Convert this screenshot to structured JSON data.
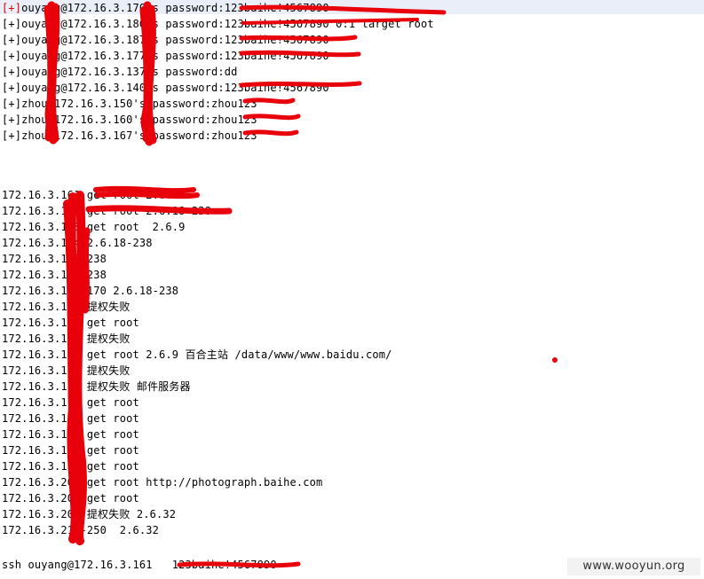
{
  "password_results": [
    {
      "prefix": "[+]",
      "text": "ouyang@172.16.3.170's password:123baihe!4567890"
    },
    {
      "prefix": "[+]",
      "text": "ouyang@172.16.3.180's password:123baihe!4567890 0:1 target root"
    },
    {
      "prefix": "[+]",
      "text": "ouyang@172.16.3.187's password:123baihe!4567890"
    },
    {
      "prefix": "[+]",
      "text": "ouyang@172.16.3.177's password:123baihe!4567890"
    },
    {
      "prefix": "[+]",
      "text": "ouyang@172.16.3.137's password:dd"
    },
    {
      "prefix": "[+]",
      "text": "ouyang@172.16.3.140's password:123baihe!4567890"
    },
    {
      "prefix": "[+]",
      "text": "zhou@172.16.3.150's password:zhou123"
    },
    {
      "prefix": "[+]",
      "text": "zhou@172.16.3.160's password:zhou123"
    },
    {
      "prefix": "[+]",
      "text": "zhou@172.16.3.167's password:zhou123"
    }
  ],
  "host_results": [
    "172.16.3.161 get root 2.6.18",
    "172.16.3.162 get root 2.6.18-238",
    "172.16.3.163 get root  2.6.9",
    "172.16.3.164 2.6.18-238",
    "172.16.3.165 238",
    "172.16.3.166 238",
    "172.16.3.167-170 2.6.18-238",
    "172.16.3.171 提权失败",
    "172.16.3.172 get root",
    "172.16.3.173 提权失败",
    "172.16.3.174 get root 2.6.9 百合主站 /data/www/www.baidu.com/",
    "172.16.3.175 提权失败",
    "172.16.3.176 提权失败 邮件服务器",
    "172.16.3.177 get root",
    "172.16.3.178 get root",
    "172.16.3.179 get root",
    "172.16.3.180 get root",
    "172.16.3.181 get root",
    "172.16.3.201 get root http://photograph.baihe.com",
    "172.16.3.202 get root",
    "172.16.3.203 提权失败 2.6.32",
    "172.16.3.210-250  2.6.32"
  ],
  "ssh_command": "ssh ouyang@172.16.3.161   123baihe!4567890",
  "watermark": "www.wooyun.org",
  "colors": {
    "redaction": "#e8000b",
    "current_line": "#e9eef9",
    "bracket": "#d00000"
  }
}
